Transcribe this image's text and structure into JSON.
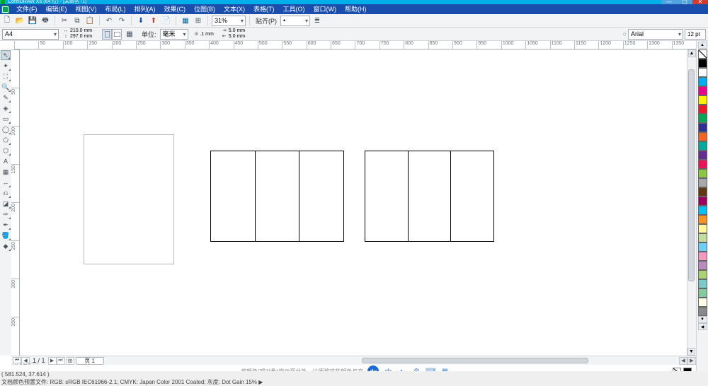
{
  "title_bar": {
    "app": "CorelDRAW X6 (64 位)",
    "doc": "[未命名 -1]"
  },
  "menu": [
    "文件(F)",
    "编辑(E)",
    "视图(V)",
    "布局(L)",
    "排列(A)",
    "效果(C)",
    "位图(B)",
    "文本(X)",
    "表格(T)",
    "工具(O)",
    "窗口(W)",
    "帮助(H)"
  ],
  "std_toolbar": {
    "zoom": "31%",
    "snap_label": "贴齐(P)"
  },
  "prop_bar": {
    "page_preset": "A4",
    "width": "210.0 mm",
    "height": "297.0 mm",
    "unit_label": "单位:",
    "unit_value": "毫米",
    "nudge": ".1 mm",
    "dup_x": "5.0 mm",
    "dup_y": "5.0 mm",
    "font": "Arial",
    "font_size": "12 pt"
  },
  "ruler_h": [
    "",
    "50",
    "100",
    "150",
    "200",
    "250",
    "300",
    "350",
    "400",
    "450",
    "500",
    "550",
    "600",
    "650",
    "700",
    "750",
    "800",
    "850",
    "900",
    "950",
    "1000",
    "1050",
    "1100",
    "1150",
    "1200",
    "1250",
    "1300",
    "1350"
  ],
  "ruler_v": [
    "",
    "50",
    "100",
    "150",
    "200",
    "250",
    "300",
    "350"
  ],
  "page_nav": {
    "current": "1",
    "total": "1",
    "page_label": "页 1"
  },
  "hints_text": "将颜色(或对象)拖动至此处，以便将这些颜色与文",
  "status_coords": "( 581.524, 37.614 )",
  "status_color": "文档颜色预置文件: RGB: sRGB IEC61966-2.1; CMYK: Japan Color 2001 Coated; 灰度: Dot Gain 15% ▶",
  "palette": [
    "#000000",
    "#ffffff",
    "#00aeef",
    "#ec008c",
    "#fff200",
    "#ed1c24",
    "#00a651",
    "#2e3192",
    "#f26522",
    "#00a99d",
    "#662d91",
    "#ed145b",
    "#8dc63f",
    "#a7a9ac",
    "#603913",
    "#9e005d",
    "#00bff3",
    "#f7941d",
    "#fff799",
    "#c4df9b",
    "#6dcff6",
    "#f49ac1",
    "#bd8cbf",
    "#acd373",
    "#7accc8",
    "#82ca9c",
    "#fffde7",
    "#898989"
  ]
}
